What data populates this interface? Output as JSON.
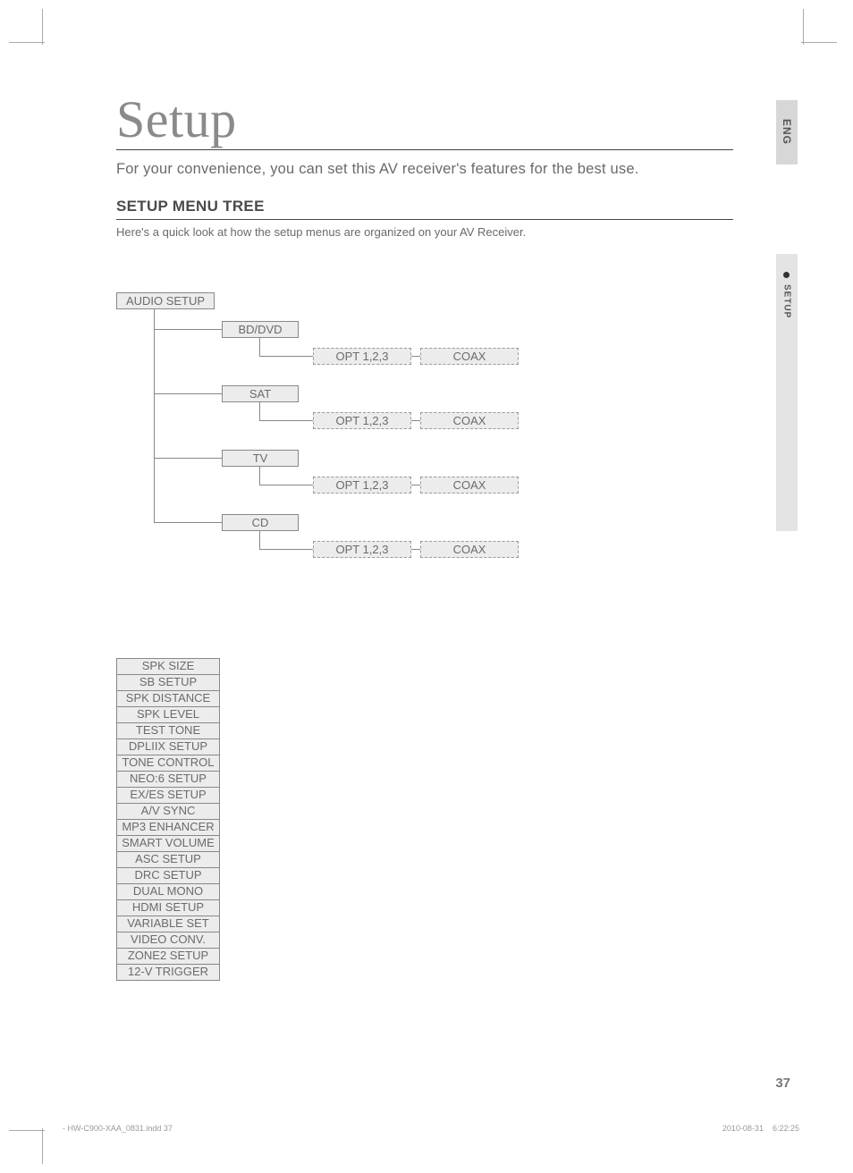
{
  "header": {
    "title": "Setup",
    "intro": "For your convenience, you can set this AV receiver's features for the best use.",
    "section": "SETUP MENU TREE",
    "sub": "Here's a quick look at how the setup menus are organized on your AV Receiver."
  },
  "tree": {
    "root": "AUDIO SETUP",
    "branches": [
      {
        "label": "BD/DVD",
        "leaves": [
          "OPT 1,2,3",
          "COAX"
        ]
      },
      {
        "label": "SAT",
        "leaves": [
          "OPT 1,2,3",
          "COAX"
        ]
      },
      {
        "label": "TV",
        "leaves": [
          "OPT 1,2,3",
          "COAX"
        ]
      },
      {
        "label": "CD",
        "leaves": [
          "OPT 1,2,3",
          "COAX"
        ]
      }
    ],
    "stack": [
      "SPK SIZE",
      "SB SETUP",
      "SPK DISTANCE",
      "SPK LEVEL",
      "TEST TONE",
      "DPLIIX SETUP",
      "TONE CONTROL",
      "NEO:6 SETUP",
      "EX/ES SETUP",
      "A/V SYNC",
      "MP3 ENHANCER",
      "SMART VOLUME",
      "ASC SETUP",
      "DRC SETUP",
      "DUAL MONO",
      "HDMI SETUP",
      "VARIABLE SET",
      "VIDEO CONV.",
      "ZONE2 SETUP",
      "12-V TRIGGER"
    ]
  },
  "side": {
    "lang": "ENG",
    "section": "SETUP"
  },
  "footer": {
    "page": "37",
    "left": "- HW-C900-XAA_0831.indd   37",
    "right_date": "2010-08-31",
    "right_time": "6:22:25"
  }
}
